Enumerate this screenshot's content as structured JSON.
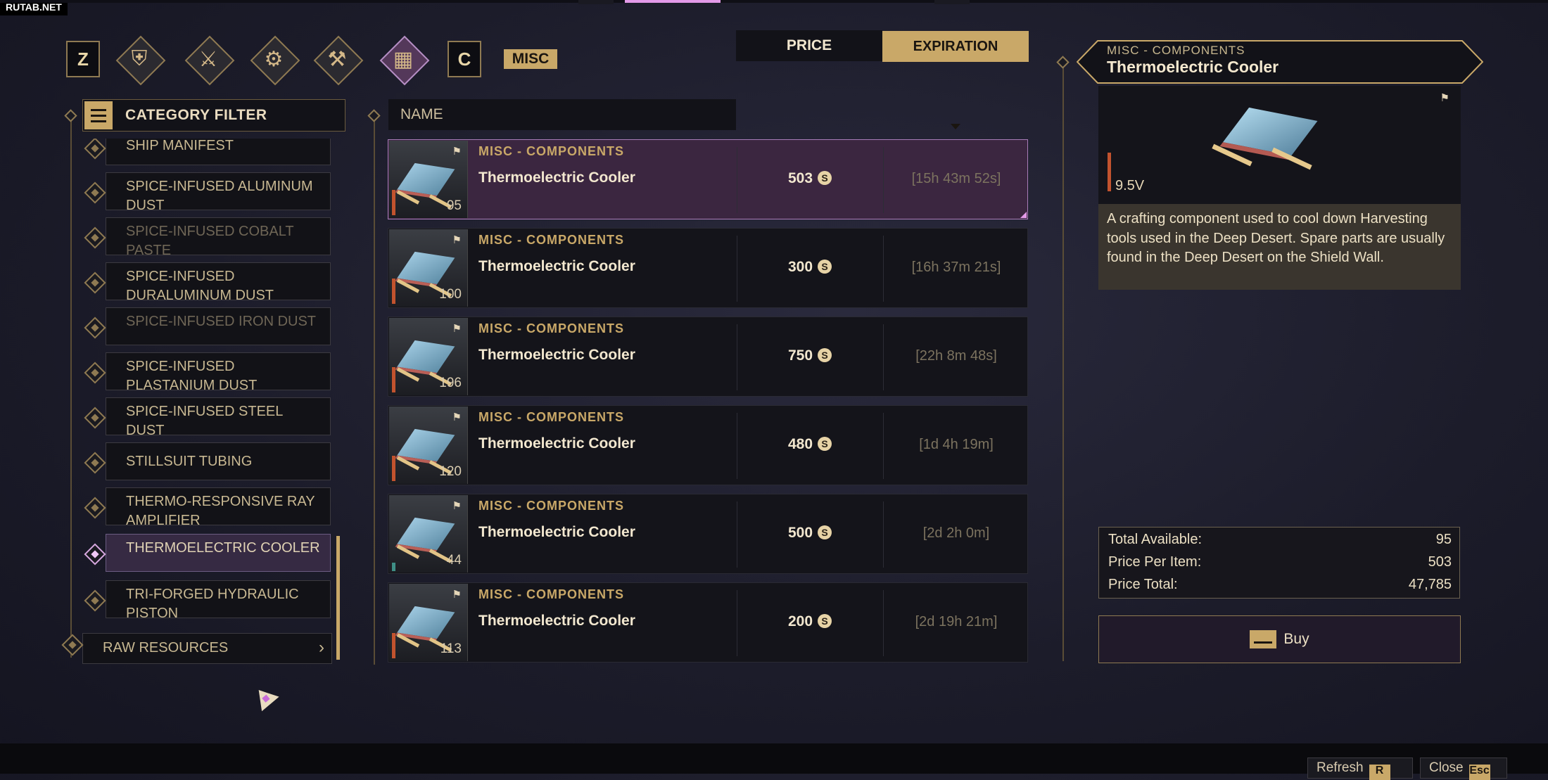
{
  "watermark": "RUTAB.NET",
  "tabs": {
    "prev_key": "Z",
    "next_key": "C",
    "active_label": "MISC",
    "categories": [
      {
        "icon": "armor-icon"
      },
      {
        "icon": "weapons-icon"
      },
      {
        "icon": "utility-icon"
      },
      {
        "icon": "tools-icon"
      },
      {
        "icon": "misc-grid-icon",
        "active": true
      }
    ]
  },
  "filter": {
    "title": "CATEGORY FILTER",
    "items": [
      {
        "label": "SHIP MANIFEST"
      },
      {
        "label": "SPICE-INFUSED ALUMINUM DUST"
      },
      {
        "label": "SPICE-INFUSED COBALT PASTE",
        "dim": true
      },
      {
        "label": "SPICE-INFUSED DURALUMINUM DUST"
      },
      {
        "label": "SPICE-INFUSED IRON DUST",
        "dim": true
      },
      {
        "label": "SPICE-INFUSED PLASTANIUM DUST"
      },
      {
        "label": "SPICE-INFUSED STEEL DUST"
      },
      {
        "label": "STILLSUIT TUBING"
      },
      {
        "label": "THERMO-RESPONSIVE RAY AMPLIFIER"
      },
      {
        "label": "THERMOELECTRIC COOLER",
        "active": true
      },
      {
        "label": "TRI-FORGED HYDRAULIC PISTON"
      }
    ],
    "raw_resources": "RAW RESOURCES"
  },
  "table": {
    "headers": {
      "name": "NAME",
      "price": "PRICE",
      "expiration": "EXPIRATION"
    },
    "rows": [
      {
        "category": "MISC - COMPONENTS",
        "name": "Thermoelectric Cooler",
        "qty": "95",
        "price": "503",
        "expiration": "[15h 43m 52s]",
        "selected": true
      },
      {
        "category": "MISC - COMPONENTS",
        "name": "Thermoelectric Cooler",
        "qty": "100",
        "price": "300",
        "expiration": "[16h 37m 21s]"
      },
      {
        "category": "MISC - COMPONENTS",
        "name": "Thermoelectric Cooler",
        "qty": "196",
        "price": "750",
        "expiration": "[22h 8m 48s]"
      },
      {
        "category": "MISC - COMPONENTS",
        "name": "Thermoelectric Cooler",
        "qty": "120",
        "price": "480",
        "expiration": "[1d 4h 19m]"
      },
      {
        "category": "MISC - COMPONENTS",
        "name": "Thermoelectric Cooler",
        "qty": "44",
        "price": "500",
        "expiration": "[2d 2h 0m]"
      },
      {
        "category": "MISC - COMPONENTS",
        "name": "Thermoelectric Cooler",
        "qty": "113",
        "price": "200",
        "expiration": "[2d 19h 21m]"
      }
    ]
  },
  "detail": {
    "category": "MISC - COMPONENTS",
    "name": "Thermoelectric Cooler",
    "voltage": "9.5V",
    "description": "A crafting component used to cool down Harvesting tools used in the Deep Desert. Spare parts are usually found in the Deep Desert on the Shield Wall.",
    "summary": {
      "total_available_label": "Total Available:",
      "total_available": "95",
      "price_per_item_label": "Price Per Item:",
      "price_per_item": "503",
      "price_total_label": "Price Total:",
      "price_total": "47,785"
    },
    "buy_label": "Buy"
  },
  "bottom": {
    "refresh_label": "Refresh",
    "refresh_key": "R",
    "close_label": "Close",
    "close_key": "Esc"
  },
  "colors": {
    "accent": "#c9a868",
    "selected": "#3b2640",
    "highlight": "#e39ae8"
  }
}
